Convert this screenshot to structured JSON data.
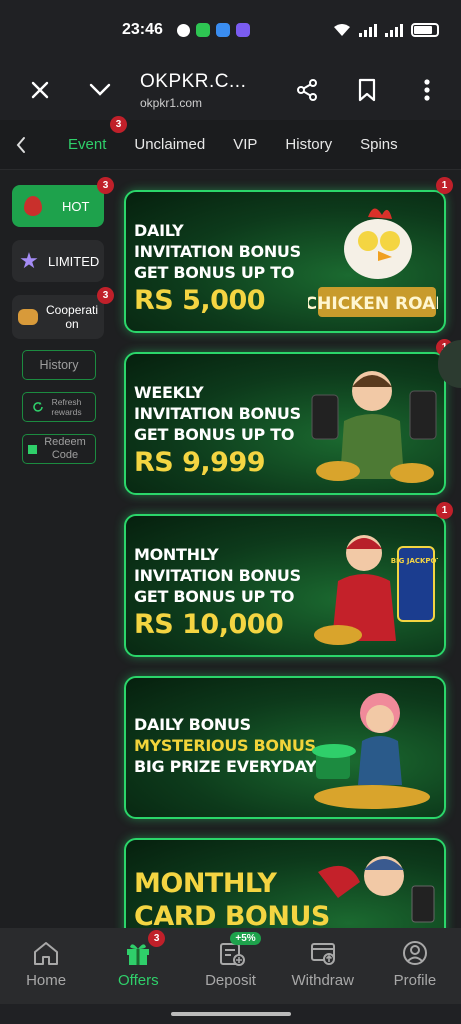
{
  "status_bar": {
    "time": "23:46"
  },
  "browser": {
    "title": "OKPKR.C...",
    "url": "okpkr1.com"
  },
  "tabs": [
    {
      "label": "Event",
      "badge": "3"
    },
    {
      "label": "Unclaimed"
    },
    {
      "label": "VIP"
    },
    {
      "label": "History"
    },
    {
      "label": "Spins"
    }
  ],
  "sidebar": {
    "hot": {
      "label": "HOT",
      "badge": "3"
    },
    "limited": {
      "label": "LIMITED"
    },
    "cooperation": {
      "label": "Cooperati\non",
      "badge": "3"
    },
    "history": "History",
    "refresh": "Refresh rewards",
    "redeem": "Redeem Code"
  },
  "banners": [
    {
      "lines": [
        "DAILY",
        "INVITATION BONUS",
        "GET BONUS UP TO"
      ],
      "big": "RS 5,000",
      "badge": "1",
      "art_text": "CHICKEN ROAD"
    },
    {
      "lines": [
        "WEEKLY",
        "INVITATION BONUS",
        "GET BONUS UP TO"
      ],
      "big": "RS 9,999",
      "badge": "1"
    },
    {
      "lines": [
        "MONTHLY",
        "INVITATION BONUS",
        "GET BONUS UP TO"
      ],
      "big": "RS 10,000",
      "badge": "1",
      "art_text": "BIG JACKPOT"
    },
    {
      "lines": [
        "DAILY BONUS",
        "MYSTERIOUS BONUS",
        "BIG PRIZE EVERYDAY"
      ]
    },
    {
      "lines": [
        "MONTHLY",
        "CARD BONUS"
      ]
    }
  ],
  "bottom_nav": [
    {
      "label": "Home"
    },
    {
      "label": "Offers",
      "badge": "3"
    },
    {
      "label": "Deposit",
      "pill": "+5%"
    },
    {
      "label": "Withdraw"
    },
    {
      "label": "Profile"
    }
  ],
  "colors": {
    "accent": "#2fcf6a",
    "badge_red": "#c0202a",
    "bg": "#1e1f21",
    "gold": "#f4d542"
  }
}
